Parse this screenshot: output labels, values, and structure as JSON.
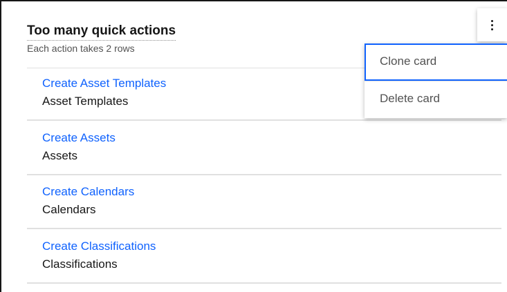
{
  "card": {
    "title": "Too many quick actions",
    "subtitle": "Each action takes 2 rows"
  },
  "actions": [
    {
      "link": "Create Asset Templates",
      "label": "Asset Templates"
    },
    {
      "link": "Create Assets",
      "label": "Assets"
    },
    {
      "link": "Create Calendars",
      "label": "Calendars"
    },
    {
      "link": "Create Classifications",
      "label": "Classifications"
    }
  ],
  "overflow_menu": {
    "icon": "overflow-menu-vertical-icon",
    "items": [
      {
        "label": "Clone card"
      },
      {
        "label": "Delete card"
      }
    ]
  },
  "colors": {
    "link": "#0f62fe",
    "focus": "#0f62fe",
    "text": "#161616",
    "divider": "#e0e0e0"
  }
}
